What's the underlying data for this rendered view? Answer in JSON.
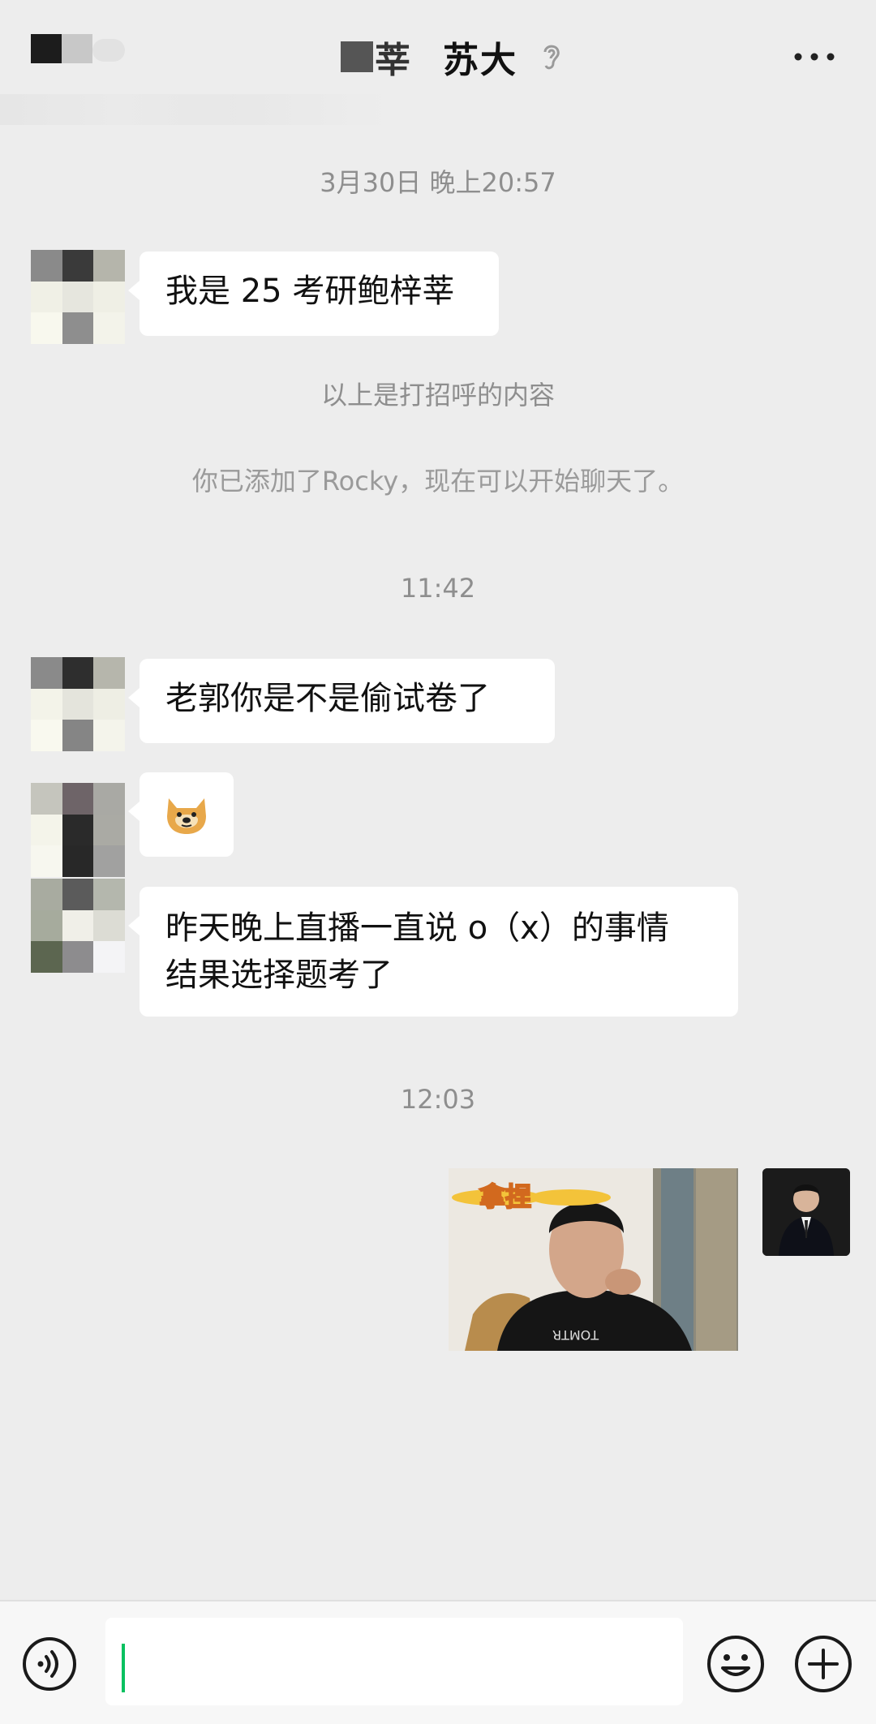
{
  "header": {
    "title": "苏大",
    "name_fragment": "莘"
  },
  "messages": {
    "time1": "3月30日 晚上20:57",
    "greeting": "我是 25 考研鲍梓莘",
    "greeting_note": "以上是打招呼的内容",
    "added_note": "你已添加了Rocky，现在可以开始聊天了。",
    "time2": "11:42",
    "msg1": "老郭你是不是偷试卷了",
    "msg3_line1": "昨天晚上直播一直说 o（x）的事情",
    "msg3_line2": "结果选择题考了",
    "time3": "12:03",
    "sticker_caption": "拿捏",
    "shirt_text": "TOMTR"
  },
  "icons": {
    "ear": "ear-icon",
    "more": "more-icon",
    "voice": "voice-icon",
    "emoji": "emoji-icon",
    "plus": "plus-icon",
    "doge": "doge-emoji-icon"
  },
  "colors": {
    "background": "#ededed",
    "bubble": "#ffffff",
    "caret": "#07c160"
  }
}
